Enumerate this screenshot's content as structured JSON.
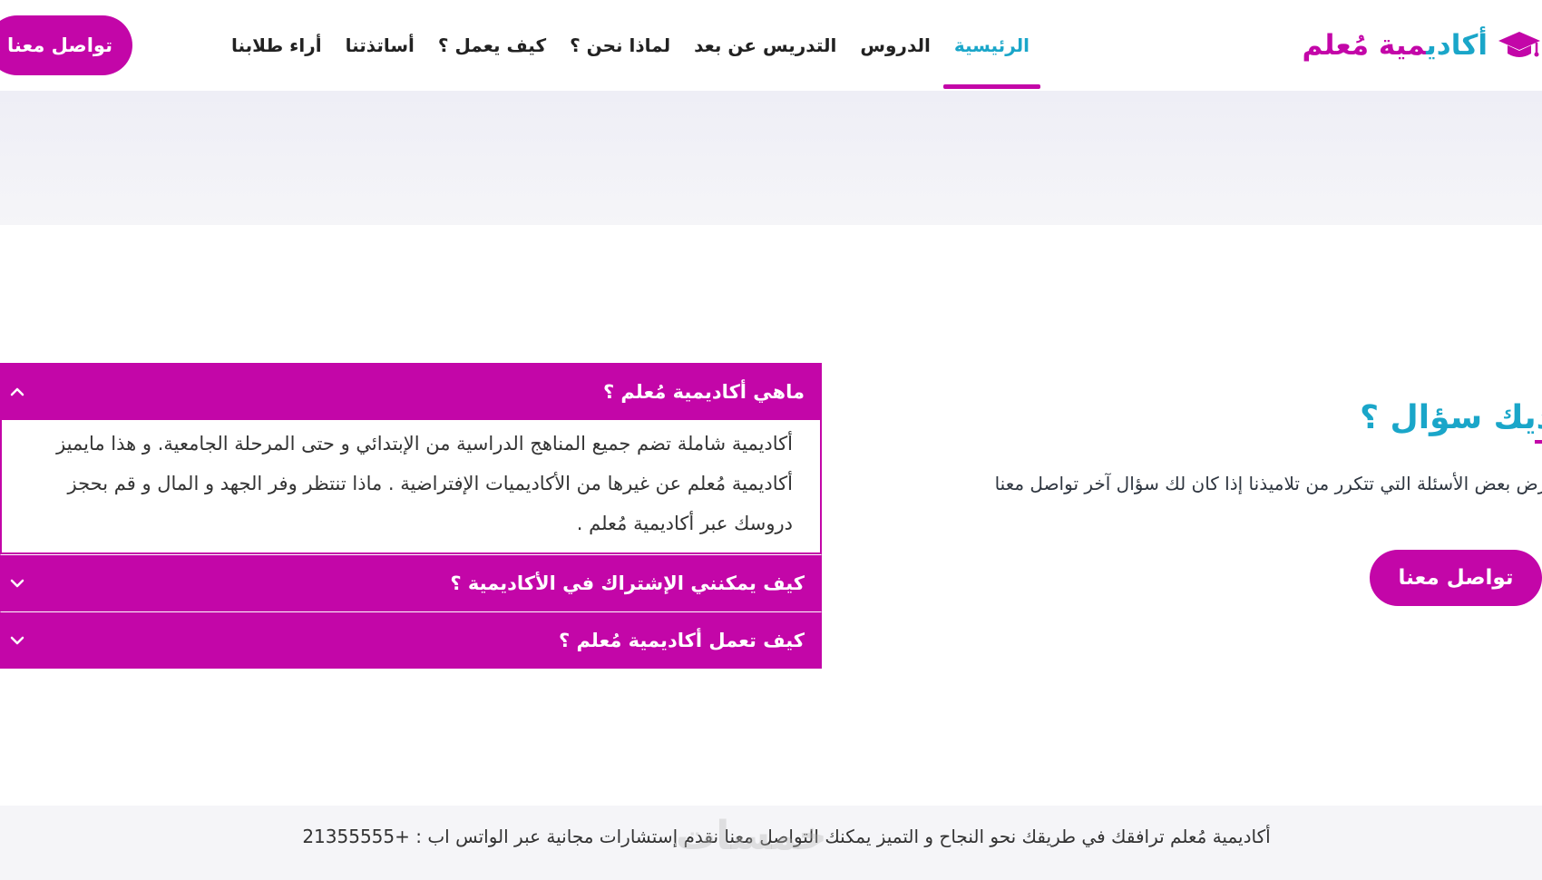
{
  "header": {
    "logo": {
      "text_part1": "أكادي",
      "text_part2": "مية مُعلم"
    },
    "nav": [
      {
        "label": "الرئيسية",
        "active": true
      },
      {
        "label": "الدروس"
      },
      {
        "label": "التدريس عن بعد"
      },
      {
        "label": "لماذا نحن ؟"
      },
      {
        "label": "كيف يعمل ؟"
      },
      {
        "label": "أساتذتنا"
      },
      {
        "label": "أراء طلابنا"
      }
    ],
    "cta_label": "تواصل معنا"
  },
  "contact": {
    "title": "لديك سؤال ؟",
    "description": "نعرض بعض الأسئلة التي تتكرر من تلاميذنا إذا كان لك سؤال آخر تواصل معنا",
    "button_label": "تواصل معنا"
  },
  "faq": [
    {
      "question": "ماهي أكاديمية مُعلم ؟",
      "expanded": true,
      "answer": "أكاديمية شاملة تضم جميع المناهج الدراسية من الإبتدائي و حتى المرحلة الجامعية. و هذا مايميز أكاديمية مُعلم عن غيرها من الأكاديميات الإفتراضية . ماذا تنتظر وفر الجهد و المال و قم بحجز دروسك عبر أكاديمية مُعلم ."
    },
    {
      "question": "كيف يمكنني الإشتراك في الأكاديمية ؟",
      "expanded": false
    },
    {
      "question": "كيف تعمل أكاديمية مُعلم ؟",
      "expanded": false
    }
  ],
  "footer": {
    "text": "أكاديمية مُعلم ترافقك في طريقك نحو النجاح و التميز يمكنك التواصل معنا نقدم إستشارات مجانية عبر الواتس اب : +21355555",
    "watermark": "خمسات"
  },
  "colors": {
    "brand_magenta": "#c306a8",
    "brand_cyan": "#1aa6c9"
  }
}
